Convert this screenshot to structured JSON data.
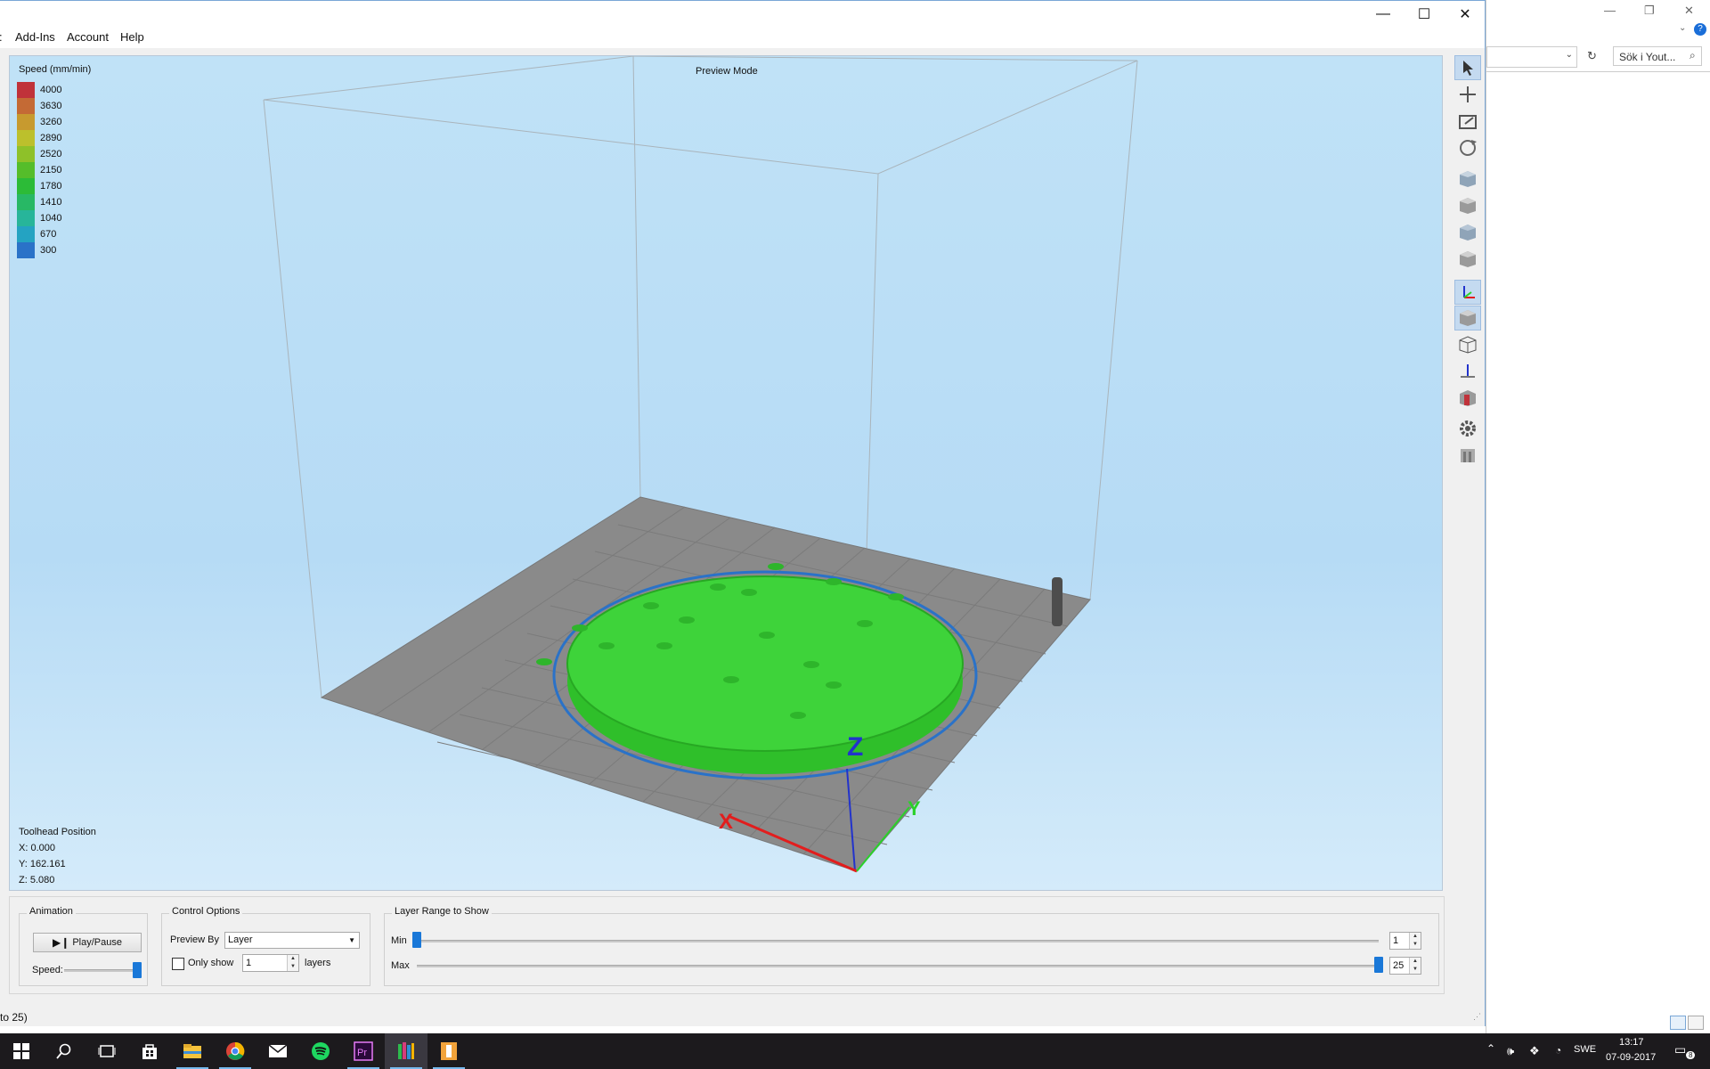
{
  "window": {
    "minimize": "—",
    "maximize": "☐",
    "close": "✕"
  },
  "menu": {
    "cut_item": ":",
    "addins": "Add-Ins",
    "account": "Account",
    "help": "Help"
  },
  "viewport": {
    "mode_label": "Preview Mode",
    "legend": {
      "title": "Speed (mm/min)",
      "items": [
        {
          "value": "4000",
          "color": "#c0323a"
        },
        {
          "value": "3630",
          "color": "#c46a35"
        },
        {
          "value": "3260",
          "color": "#c79a2f"
        },
        {
          "value": "2890",
          "color": "#bcc02c"
        },
        {
          "value": "2520",
          "color": "#8ec129"
        },
        {
          "value": "2150",
          "color": "#55bd2a"
        },
        {
          "value": "1780",
          "color": "#2cbb37"
        },
        {
          "value": "1410",
          "color": "#28b865"
        },
        {
          "value": "1040",
          "color": "#27b59a"
        },
        {
          "value": "670",
          "color": "#24a3c2"
        },
        {
          "value": "300",
          "color": "#2a72c8"
        }
      ]
    },
    "toolhead": {
      "title": "Toolhead Position",
      "x": "X: 0.000",
      "y": "Y: 162.161",
      "z": "Z: 5.080"
    }
  },
  "panel": {
    "animation": {
      "title": "Animation",
      "play_label": "Play/Pause",
      "speed_label": "Speed:",
      "speed_level": 1.0
    },
    "control": {
      "title": "Control Options",
      "preview_by_label": "Preview By",
      "preview_by_value": "Layer",
      "only_show_label": "Only show",
      "only_show_value": "1",
      "layers_label": "layers",
      "only_show_checked": false
    },
    "layer_range": {
      "title": "Layer Range to Show",
      "min_label": "Min",
      "max_label": "Max",
      "min_value": "1",
      "max_value": "25",
      "min_fraction": 0.0,
      "max_fraction": 1.0
    }
  },
  "statusbar": {
    "text": "to 25)"
  },
  "background_window": {
    "search_placeholder": "Sök i Yout...",
    "minimize": "—",
    "restore": "❐",
    "close": "✕",
    "help": "?"
  },
  "taskbar": {
    "apps": [
      "start-button",
      "search",
      "task-view",
      "store",
      "file-explorer",
      "chrome",
      "mail",
      "spotify",
      "premiere",
      "simplify3d",
      "app-orange"
    ],
    "lang": "SWE",
    "time": "13:17",
    "date": "07-09-2017",
    "notif_count": "8"
  }
}
